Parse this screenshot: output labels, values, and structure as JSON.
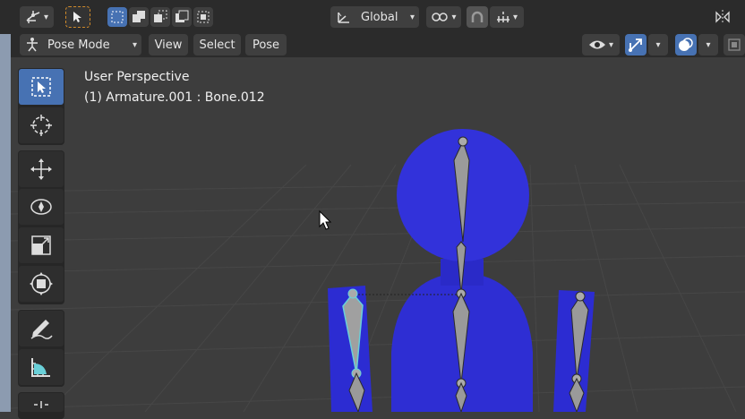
{
  "app": "Blender",
  "header": {
    "transform_orientation": "Global",
    "mode": "Pose Mode",
    "menus": [
      "View",
      "Select",
      "Pose"
    ]
  },
  "viewport": {
    "view_name": "User Perspective",
    "selection_info": "(1) Armature.001 : Bone.012"
  },
  "tools": [
    {
      "name": "select-box",
      "active": true
    },
    {
      "name": "cursor"
    },
    {
      "name": "move"
    },
    {
      "name": "rotate"
    },
    {
      "name": "scale"
    },
    {
      "name": "transform"
    },
    {
      "name": "annotate"
    },
    {
      "name": "measure"
    }
  ],
  "colors": {
    "accent": "#4772b3",
    "mesh": "#2f2fd8",
    "bone": "#9a9a9a",
    "bone_selected": "#6ad0d8",
    "grid": "#4a4a4a"
  }
}
